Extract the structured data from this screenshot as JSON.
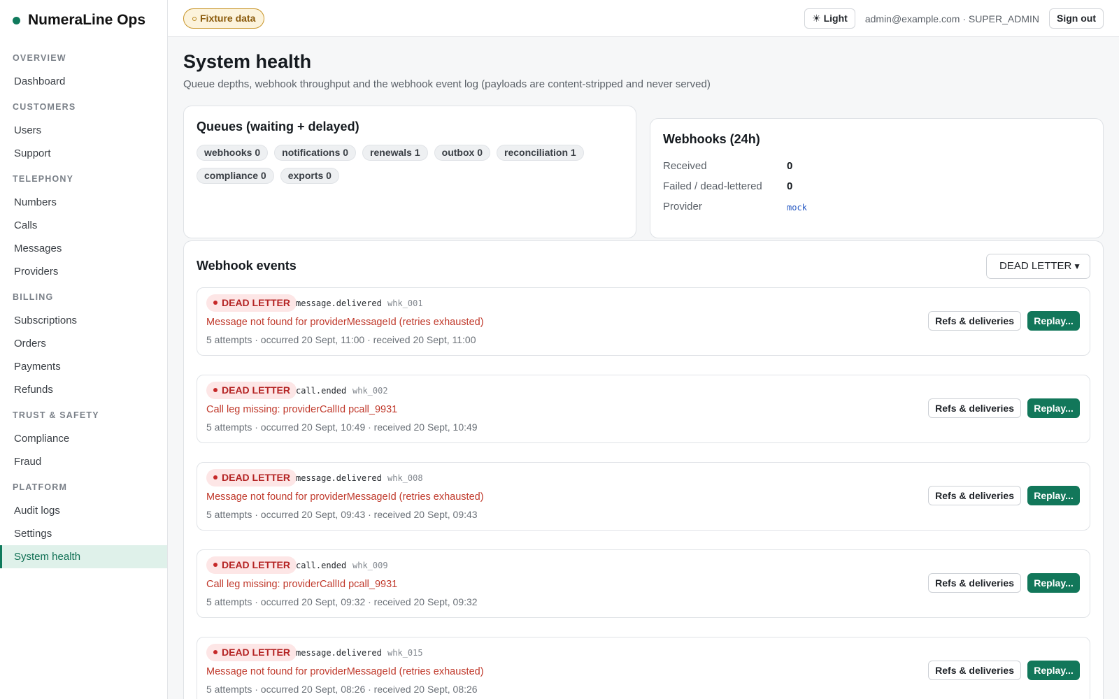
{
  "brand": {
    "name": "NumeraLine Ops",
    "dot_color": "#0f7a5c"
  },
  "sidebar": {
    "sections": [
      {
        "title": "OVERVIEW",
        "items": [
          "Dashboard"
        ]
      },
      {
        "title": "CUSTOMERS",
        "items": [
          "Users",
          "Support"
        ]
      },
      {
        "title": "TELEPHONY",
        "items": [
          "Numbers",
          "Calls",
          "Messages",
          "Providers"
        ]
      },
      {
        "title": "BILLING",
        "items": [
          "Subscriptions",
          "Orders",
          "Payments",
          "Refunds"
        ]
      },
      {
        "title": "TRUST & SAFETY",
        "items": [
          "Compliance",
          "Fraud"
        ]
      },
      {
        "title": "PLATFORM",
        "items": [
          "Audit logs",
          "Settings",
          "System health"
        ]
      }
    ],
    "active_item": "System health"
  },
  "topbar": {
    "fixture_badge": "Fixture data",
    "theme_button": "Light",
    "theme_icon": "sun-icon",
    "user_label": "admin@example.com · SUPER_ADMIN",
    "sign_out": "Sign out"
  },
  "page": {
    "title": "System health",
    "subtitle": "Queue depths, webhook throughput and the webhook event log (payloads are content-stripped and never served)"
  },
  "queues": {
    "title": "Queues (waiting + delayed)",
    "chips": [
      "webhooks 0",
      "notifications 0",
      "renewals 1",
      "outbox 0",
      "reconciliation 1",
      "compliance 0",
      "exports 0"
    ]
  },
  "webhooks": {
    "title": "Webhooks (24h)",
    "received_label": "Received",
    "received_value": "0",
    "failed_label": "Failed / dead-lettered",
    "failed_value": "0",
    "provider_label": "Provider",
    "provider_value": "mock"
  },
  "events": {
    "title": "Webhook events",
    "filter_value": "DEAD LETTER",
    "refs_label": "Refs & deliveries",
    "replay_label": "Replay...",
    "items": [
      {
        "status": "DEAD LETTER",
        "type": "message.delivered",
        "id": "whk_001",
        "error": "Message not found for providerMessageId (retries exhausted)",
        "meta": "5 attempts · occurred 20 Sept, 11:00 · received 20 Sept, 11:00"
      },
      {
        "status": "DEAD LETTER",
        "type": "call.ended",
        "id": "whk_002",
        "error": "Call leg missing: providerCallId pcall_9931",
        "meta": "5 attempts · occurred 20 Sept, 10:49 · received 20 Sept, 10:49"
      },
      {
        "status": "DEAD LETTER",
        "type": "message.delivered",
        "id": "whk_008",
        "error": "Message not found for providerMessageId (retries exhausted)",
        "meta": "5 attempts · occurred 20 Sept, 09:43 · received 20 Sept, 09:43"
      },
      {
        "status": "DEAD LETTER",
        "type": "call.ended",
        "id": "whk_009",
        "error": "Call leg missing: providerCallId pcall_9931",
        "meta": "5 attempts · occurred 20 Sept, 09:32 · received 20 Sept, 09:32"
      },
      {
        "status": "DEAD LETTER",
        "type": "message.delivered",
        "id": "whk_015",
        "error": "Message not found for providerMessageId (retries exhausted)",
        "meta": "5 attempts · occurred 20 Sept, 08:26 · received 20 Sept, 08:26"
      }
    ]
  }
}
